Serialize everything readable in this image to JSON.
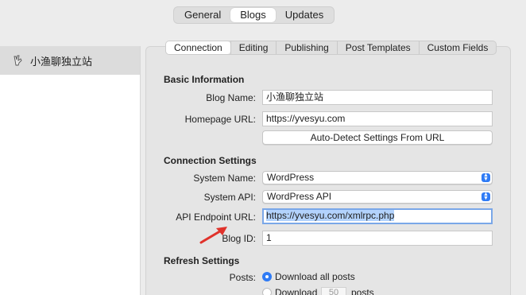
{
  "top_tabs": [
    "General",
    "Blogs",
    "Updates"
  ],
  "sidebar": {
    "items": [
      {
        "label": "小渔聊独立站",
        "icon": "peace-hand-icon"
      }
    ]
  },
  "sub_tabs": [
    "Connection",
    "Editing",
    "Publishing",
    "Post Templates",
    "Custom Fields"
  ],
  "basic": {
    "title": "Basic Information",
    "blog_name_label": "Blog Name:",
    "blog_name_value": "小渔聊独立站",
    "homepage_label": "Homepage URL:",
    "homepage_value": "https://yvesyu.com",
    "auto_detect_label": "Auto-Detect Settings From URL"
  },
  "connection": {
    "title": "Connection Settings",
    "system_name_label": "System Name:",
    "system_name_value": "WordPress",
    "system_api_label": "System API:",
    "system_api_value": "WordPress API",
    "endpoint_label": "API Endpoint URL:",
    "endpoint_value": "https://yvesyu.com/xmlrpc.php",
    "blog_id_label": "Blog ID:",
    "blog_id_value": "1"
  },
  "refresh": {
    "title": "Refresh Settings",
    "posts_label": "Posts:",
    "option_all": "Download all posts",
    "option_some": "Download",
    "count_value": "50",
    "count_suffix": "posts"
  },
  "colors": {
    "accent": "#2f7bf5",
    "annotation_arrow": "#e0322b"
  }
}
